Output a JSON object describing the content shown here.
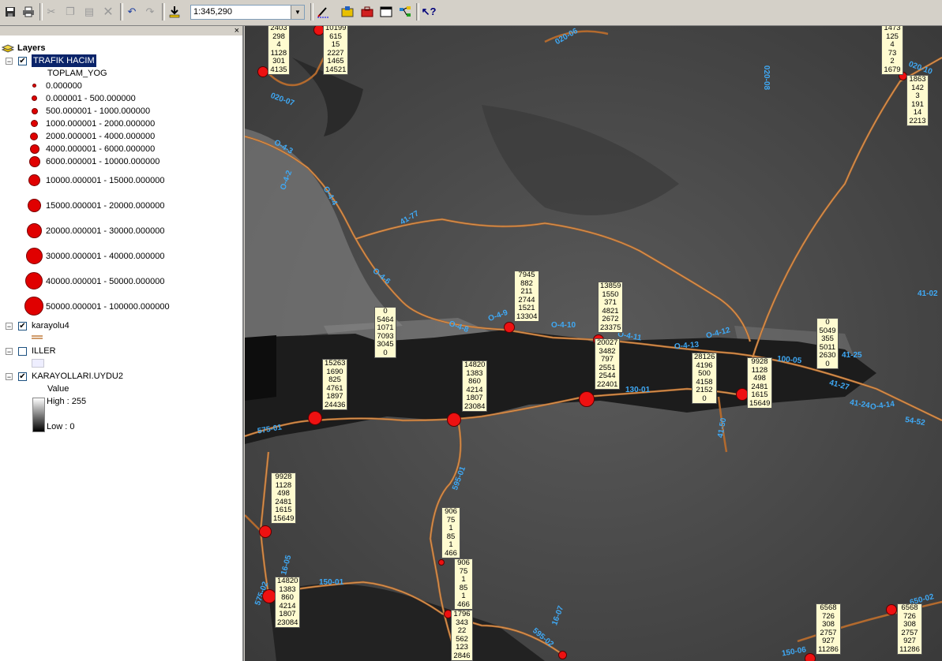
{
  "toolbar": {
    "scale_value": "1:345,290",
    "icons": [
      "save-icon",
      "print-icon",
      "cut-icon",
      "copy-icon",
      "paste-icon",
      "delete-icon",
      "undo-icon",
      "redo-icon",
      "add-data-icon",
      "editor-icon",
      "arctoolbox-icon",
      "arccatalog-icon",
      "window-icon",
      "model-icon",
      "whats-this-icon"
    ]
  },
  "toc": {
    "title": "Layers",
    "close": "×",
    "layers": [
      {
        "name": "TRAFIK HACIM",
        "checked": true,
        "field": "TOPLAM_YOG",
        "classes": [
          "0.000000",
          "0.000001 - 500.000000",
          "500.000001 - 1000.000000",
          "1000.000001 - 2000.000000",
          "2000.000001 - 4000.000000",
          "4000.000001 - 6000.000000",
          "6000.000001 - 10000.000000",
          "10000.000001 - 15000.000000",
          "15000.000001 - 20000.000000",
          "20000.000001 - 30000.000000",
          "30000.000001 - 40000.000000",
          "40000.000001 - 50000.000000",
          "50000.000001 - 100000.000000"
        ]
      },
      {
        "name": "karayolu4",
        "checked": true
      },
      {
        "name": "ILLER",
        "checked": false
      },
      {
        "name": "KARAYOLLARI.UYDU2",
        "checked": true,
        "value_label": "Value",
        "high": "High : 255",
        "low": "Low : 0"
      }
    ]
  },
  "map": {
    "road_labels": [
      "020-06",
      "020-07",
      "020-10",
      "020-08",
      "O-4-3",
      "O-4-2",
      "O-4-4",
      "41-77",
      "O-4-6",
      "O-4-8",
      "O-4-9",
      "O-4-10",
      "O-4-11",
      "O-4-12",
      "O-4-13",
      "41-25",
      "41-27",
      "41-24",
      "O-4-14",
      "54-52",
      "41-02",
      "100-05",
      "130-01",
      "41-50",
      "575-01",
      "595-01",
      "16-05",
      "150-01",
      "575-02",
      "16-07",
      "595-02",
      "150-06",
      "650-02"
    ],
    "labels": [
      {
        "lines": [
          "2403",
          "298",
          "4",
          "1128",
          "301",
          "4135"
        ]
      },
      {
        "lines": [
          "10199",
          "615",
          "15",
          "2227",
          "1465",
          "14521"
        ]
      },
      {
        "lines": [
          "1473",
          "125",
          "4",
          "73",
          "2",
          "1679"
        ]
      },
      {
        "lines": [
          "1863",
          "142",
          "3",
          "191",
          "14",
          "2213"
        ]
      },
      {
        "lines": [
          "7945",
          "882",
          "211",
          "2744",
          "1521",
          "13304"
        ]
      },
      {
        "lines": [
          "13859",
          "1550",
          "371",
          "4821",
          "2672",
          "23375"
        ]
      },
      {
        "lines": [
          "0",
          "5464",
          "1071",
          "7093",
          "3045",
          "0"
        ]
      },
      {
        "lines": [
          "0",
          "5049",
          "355",
          "5011",
          "2630",
          "0"
        ]
      },
      {
        "lines": [
          "20027",
          "3482",
          "797",
          "2551",
          "2544",
          "22401"
        ]
      },
      {
        "lines": [
          "28126",
          "4196",
          "500",
          "4158",
          "2152",
          "0"
        ]
      },
      {
        "lines": [
          "9928",
          "1128",
          "498",
          "2481",
          "1615",
          "15649"
        ]
      },
      {
        "lines": [
          "15263",
          "1690",
          "825",
          "4761",
          "1897",
          "24436"
        ]
      },
      {
        "lines": [
          "14820",
          "1383",
          "860",
          "4214",
          "1807",
          "23084"
        ]
      },
      {
        "lines": [
          "9928",
          "1128",
          "498",
          "2481",
          "1615",
          "15649"
        ]
      },
      {
        "lines": [
          "906",
          "75",
          "1",
          "85",
          "1",
          "466"
        ]
      },
      {
        "lines": [
          "906",
          "75",
          "1",
          "85",
          "1",
          "466"
        ]
      },
      {
        "lines": [
          "14820",
          "1383",
          "860",
          "4214",
          "1807",
          "23084"
        ]
      },
      {
        "lines": [
          "1796",
          "343",
          "22",
          "562",
          "123",
          "2846"
        ]
      },
      {
        "lines": [
          "6568",
          "726",
          "308",
          "2757",
          "927",
          "11286"
        ]
      },
      {
        "lines": [
          "6568",
          "726",
          "308",
          "2757",
          "927",
          "11286"
        ]
      }
    ]
  }
}
